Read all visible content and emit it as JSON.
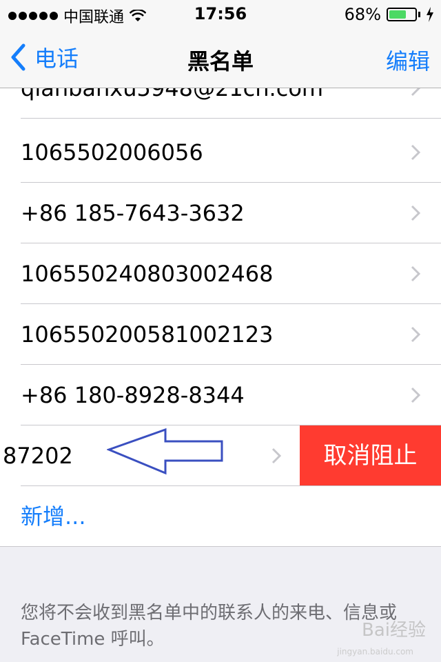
{
  "status": {
    "carrier": "中国联通",
    "time": "17:56",
    "battery_text": "68%",
    "battery_level": 0.68
  },
  "nav": {
    "back_label": "电话",
    "title": "黑名单",
    "edit_label": "编辑"
  },
  "entries": [
    "qianbanxu5948@21cn.com",
    "1065502006056",
    "+86 185-7643-3632",
    "106550240803002468",
    "106550200581002123",
    "+86 180-8928-8344"
  ],
  "swiped_entry": {
    "text": "87202",
    "action_label": "取消阻止"
  },
  "add_label": "新增...",
  "footer_note": "您将不会收到黑名单中的联系人的来电、信息或 FaceTime 呼叫。",
  "watermark": {
    "main": "Bai经验",
    "sub": "jingyan.baidu.com"
  },
  "colors": {
    "accent": "#157efb",
    "destructive": "#ff3b30",
    "battery": "#4cd964",
    "annotation_arrow": "#3a4fc0"
  }
}
